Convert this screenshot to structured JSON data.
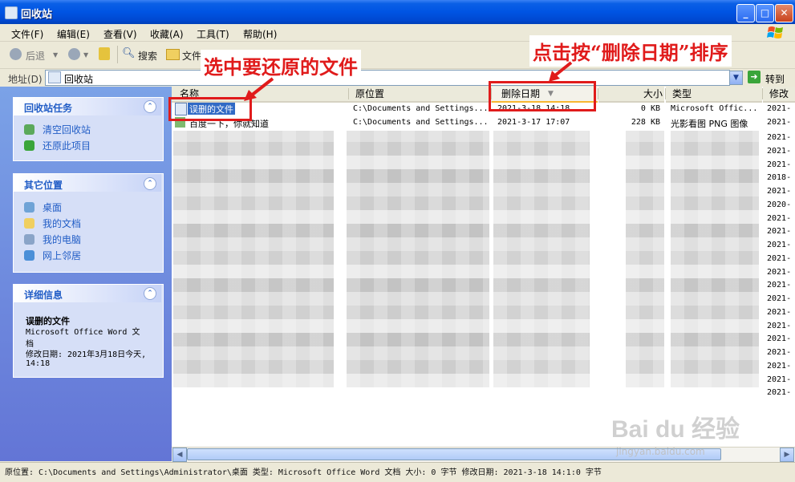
{
  "window": {
    "title": "回收站",
    "min": "_",
    "max": "□",
    "close": "✕"
  },
  "menu": [
    "文件(F)",
    "编辑(E)",
    "查看(V)",
    "收藏(A)",
    "工具(T)",
    "帮助(H)"
  ],
  "toolbar": {
    "back": "后退",
    "search": "搜索",
    "folders": "文件"
  },
  "address": {
    "label": "地址(D)",
    "value": "回收站",
    "go": "转到"
  },
  "panes": {
    "tasks": {
      "title": "回收站任务",
      "items": [
        "清空回收站",
        "还原此项目"
      ]
    },
    "places": {
      "title": "其它位置",
      "items": [
        "桌面",
        "我的文档",
        "我的电脑",
        "网上邻居"
      ]
    },
    "details": {
      "title": "详细信息",
      "name": "误删的文件",
      "type": "Microsoft Office Word 文档",
      "modified": "修改日期: 2021年3月18日今天, 14:18"
    }
  },
  "columns": {
    "name": "名称",
    "origin": "原位置",
    "deleted": "删除日期",
    "size": "大小",
    "type": "类型",
    "modified": "修改"
  },
  "rows": [
    {
      "name": "误删的文件",
      "origin": "C:\\Documents and Settings...",
      "deleted": "2021-3-18 14:18",
      "size": "0 KB",
      "type": "Microsoft Offic...",
      "modified": "2021-"
    },
    {
      "name": "百度一下，你就知道",
      "origin": "C:\\Documents and Settings...",
      "deleted": "2021-3-17 17:07",
      "size": "228 KB",
      "type": "光影看图 PNG 图像",
      "modified": "2021-"
    }
  ],
  "blurred_modified": [
    "2021-",
    "2021-",
    "2021-",
    "2018-",
    "2021-",
    "2020-",
    "2021-",
    "2021-",
    "2021-",
    "2021-",
    "2021-",
    "2021-",
    "2021-",
    "2021-",
    "2021-",
    "2021-",
    "2021-",
    "2021-",
    "2021-",
    "2021-"
  ],
  "statusbar": "原位置: C:\\Documents and Settings\\Administrator\\桌面 类型: Microsoft Office Word 文档 大小: 0 字节 修改日期: 2021-3-18 14:1:0 字节",
  "annotations": {
    "select_file": "选中要还原的文件",
    "sort_by_date": "点击按“删除日期”排序"
  },
  "watermark": {
    "brand": "Bai du 经验",
    "url": "jingyan.baidu.com"
  }
}
